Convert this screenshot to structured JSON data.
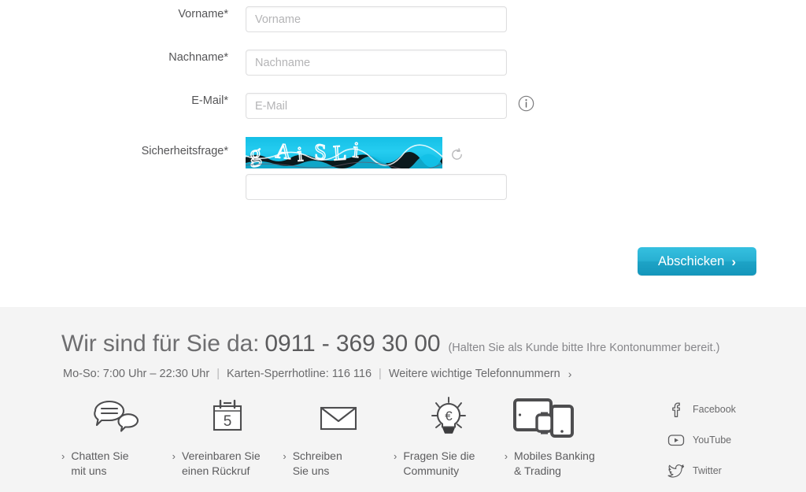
{
  "form": {
    "fields": [
      {
        "label": "Vorname*",
        "placeholder": "Vorname",
        "value": "",
        "name": "vorname"
      },
      {
        "label": "Nachname*",
        "placeholder": "Nachname",
        "value": "",
        "name": "nachname"
      },
      {
        "label": "E-Mail*",
        "placeholder": "E-Mail",
        "value": "",
        "name": "email"
      }
    ],
    "captcha": {
      "label": "Sicherheitsfrage*",
      "challenge_text": "gAiSLi",
      "input_value": "",
      "input_placeholder": "",
      "refresh_icon": "refresh-icon",
      "background_color": "#1ac3e8"
    },
    "email_info_icon": "info-icon",
    "submit": {
      "label": "Abschicken",
      "chevron": "›",
      "color": "#28b0d2"
    }
  },
  "footer": {
    "headline_lead": "Wir sind für Sie da:",
    "headline_number": "0911 - 369 30 00",
    "headline_note": "(Halten Sie als Kunde bitte Ihre Kontonummer bereit.)",
    "hours": "Mo-So: 7:00 Uhr – 22:30 Uhr",
    "hotline": "Karten-Sperrhotline: 116 116",
    "more_numbers": "Weitere wichtige Telefonnummern",
    "more_numbers_arrow": "›",
    "separator": "|",
    "services": [
      {
        "icon": "chat-bubbles-icon",
        "line1": "Chatten Sie",
        "line2": "mit uns",
        "chevron": "›"
      },
      {
        "icon": "calendar-5-icon",
        "line1": "Vereinbaren Sie",
        "line2": "einen Rückruf",
        "chevron": "›"
      },
      {
        "icon": "envelope-icon",
        "line1": "Schreiben",
        "line2": "Sie uns",
        "chevron": "›"
      },
      {
        "icon": "lightbulb-euro-icon",
        "line1": "Fragen Sie die",
        "line2": "Community",
        "chevron": "›"
      },
      {
        "icon": "devices-icon",
        "line1": "Mobiles Banking",
        "line2": "& Trading",
        "chevron": "›"
      }
    ],
    "social": [
      {
        "icon": "facebook-icon",
        "label": "Facebook"
      },
      {
        "icon": "youtube-icon",
        "label": "YouTube"
      },
      {
        "icon": "twitter-icon",
        "label": "Twitter"
      }
    ],
    "background_color": "#f4f4f4"
  }
}
